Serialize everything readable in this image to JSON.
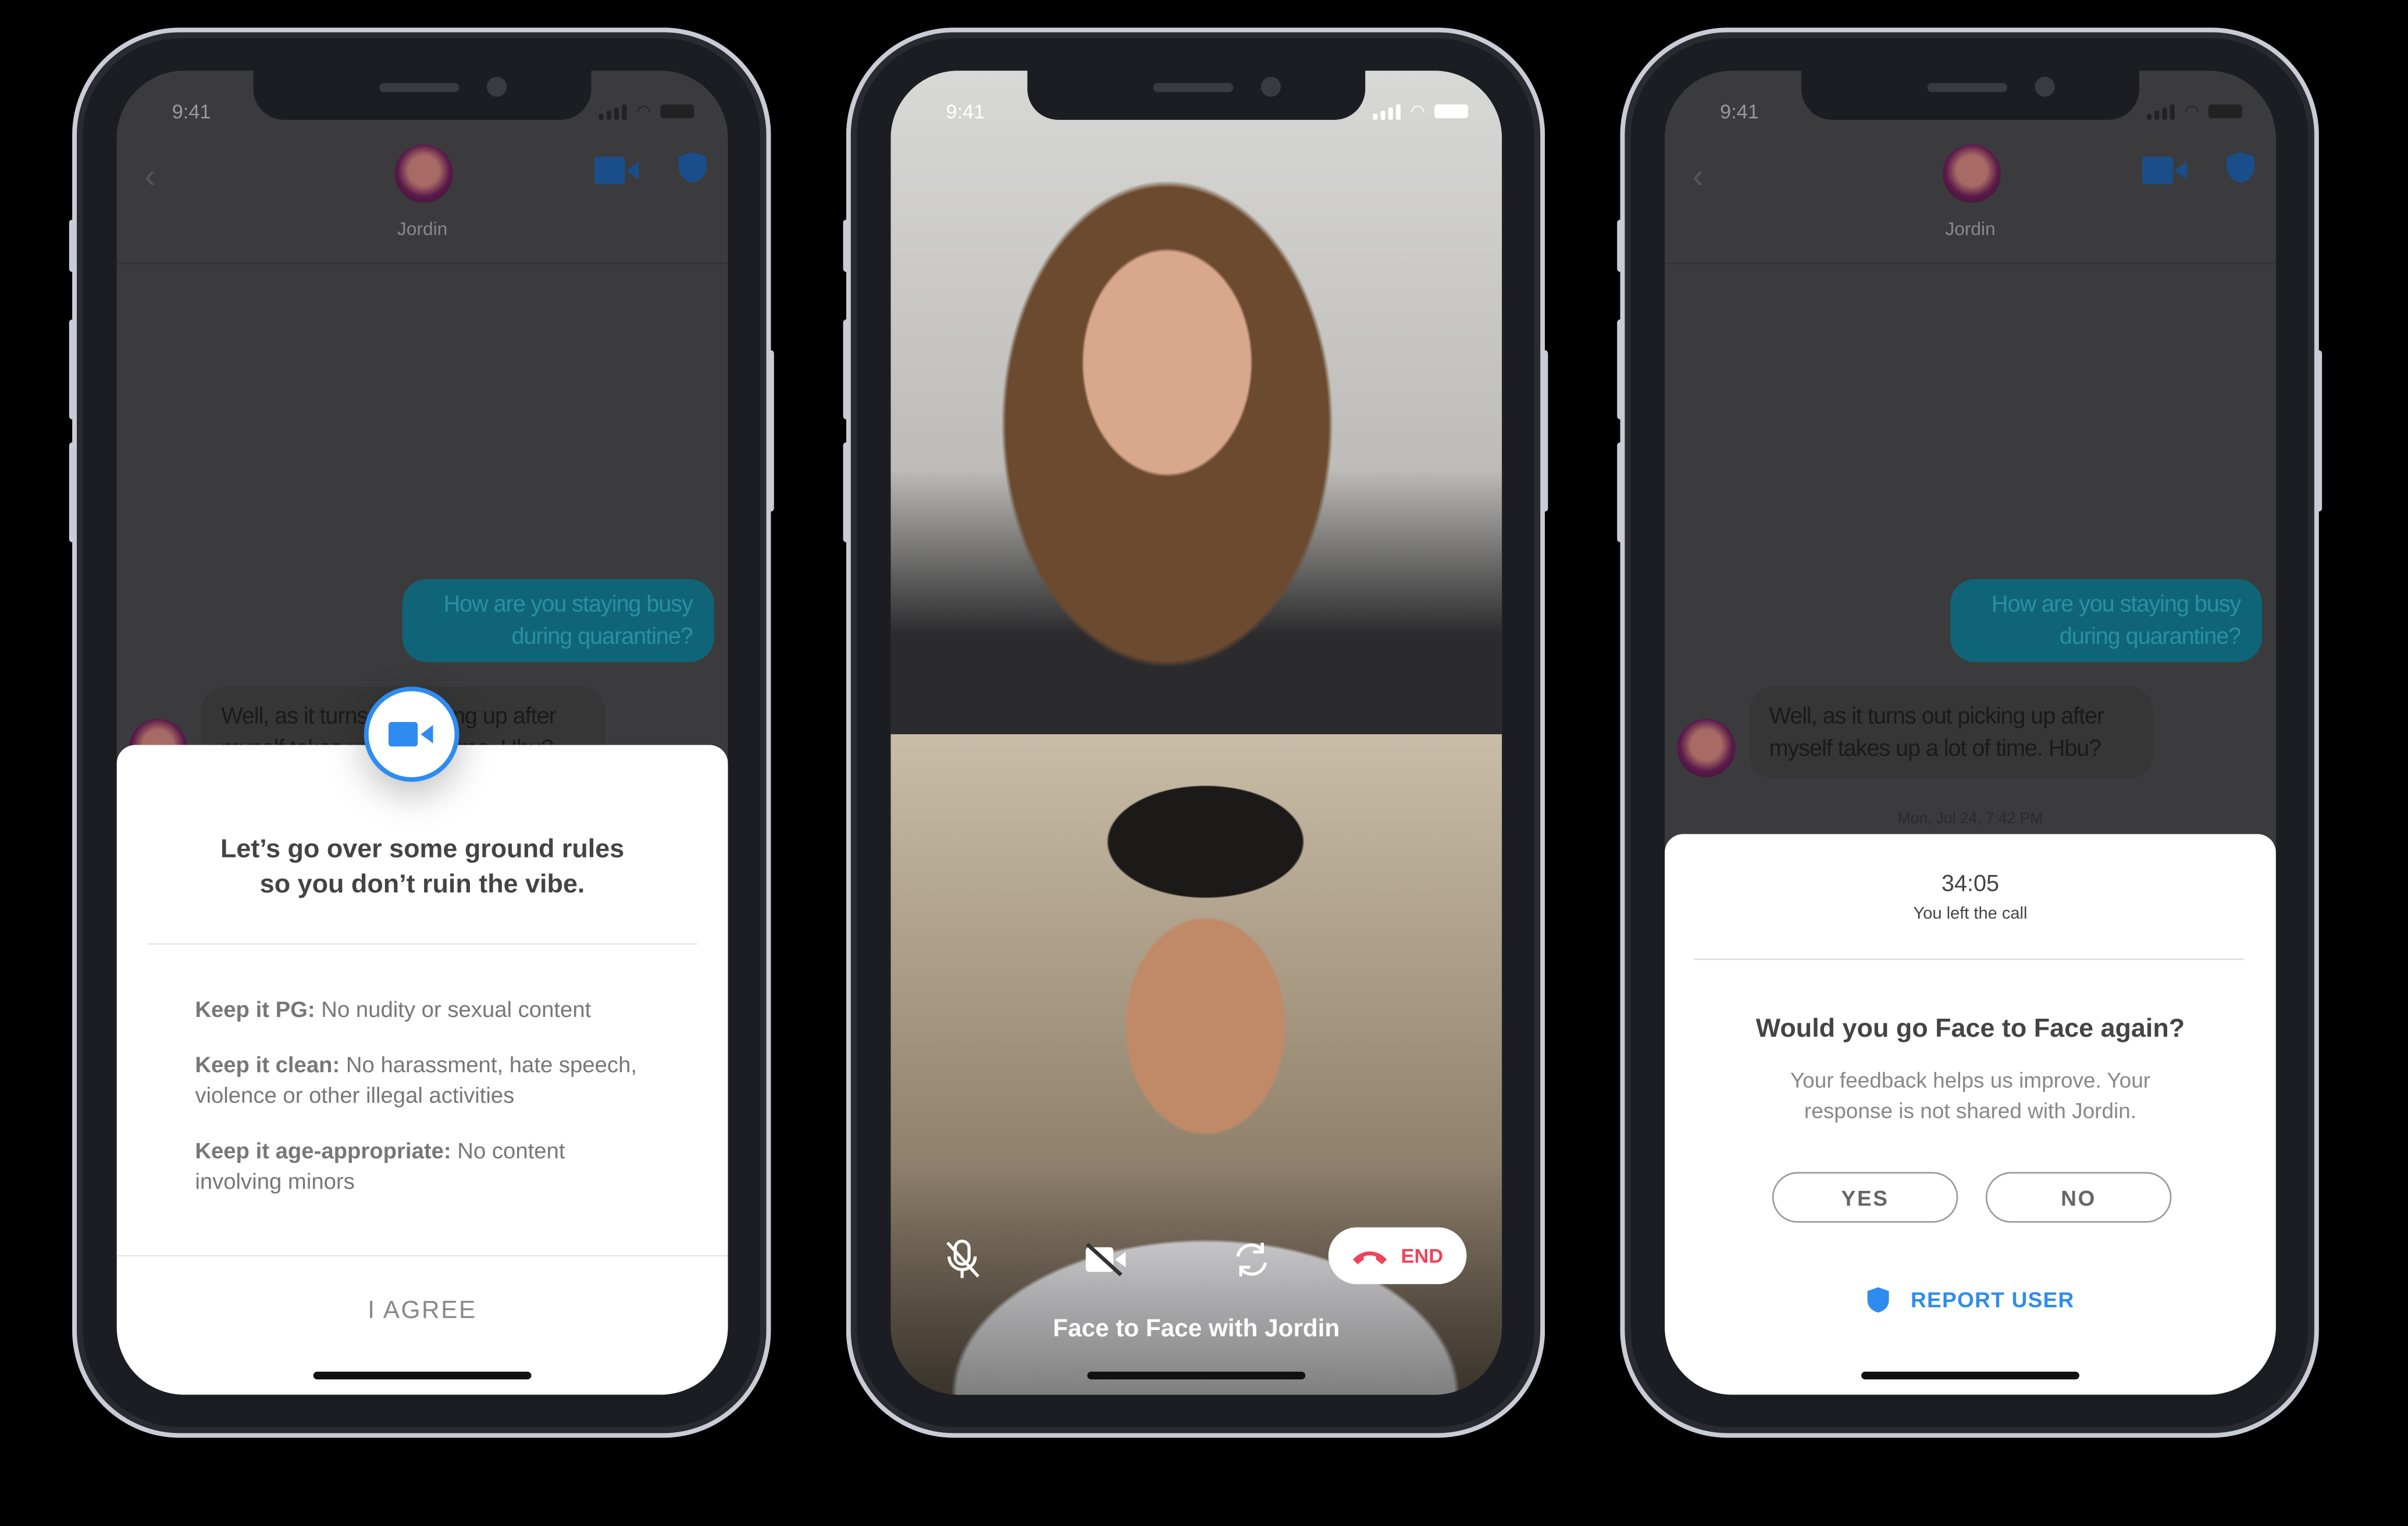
{
  "status_bar": {
    "time": "9:41"
  },
  "chat": {
    "contact_name": "Jordin",
    "sent_message": "How are you staying busy during quarantine?",
    "received_message": "Well, as it turns out picking up after myself takes up a lot of time. Hbu?",
    "timestamp": "Mon, Jul 24, 7:42 PM"
  },
  "rules_modal": {
    "title_line1": "Let’s go over some ground rules",
    "title_line2": "so you don’t ruin the vibe.",
    "rules": [
      {
        "label": "Keep it PG:",
        "text": " No nudity or sexual content"
      },
      {
        "label": "Keep it clean:",
        "text": " No harassment, hate speech, violence or other illegal activities"
      },
      {
        "label": "Keep it age-appropriate:",
        "text": " No content involving minors"
      }
    ],
    "agree_label": "I AGREE"
  },
  "video_call": {
    "caption": "Face to Face with Jordin",
    "end_label": "END",
    "controls": [
      "mic-off-icon",
      "video-off-icon",
      "camera-flip-icon",
      "hang-up-icon"
    ]
  },
  "feedback_modal": {
    "duration": "34:05",
    "status": "You left the call",
    "title": "Would you go Face to Face again?",
    "subtitle": "Your feedback helps us improve. Your response is not shared with Jordin.",
    "yes_label": "YES",
    "no_label": "NO",
    "report_label": "REPORT USER"
  },
  "colors": {
    "accent": "#2e8cf0",
    "end": "#f0425a",
    "sent_bubble": "#1ba3c6"
  }
}
